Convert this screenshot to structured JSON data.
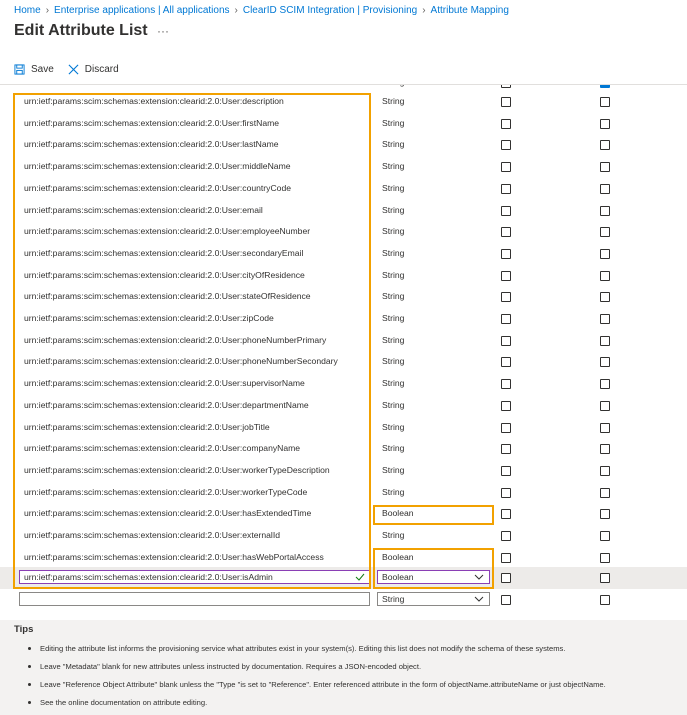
{
  "breadcrumb": {
    "items": [
      "Home",
      "Enterprise applications | All applications",
      "ClearID SCIM Integration | Provisioning",
      "Attribute Mapping"
    ]
  },
  "page": {
    "title": "Edit Attribute List",
    "more": "···"
  },
  "toolbar": {
    "save_label": "Save",
    "discard_label": "Discard"
  },
  "partial_row_type": "String",
  "rows": [
    {
      "name": "urn:ietf:params:scim:schemas:extension:clearid:2.0:User:description",
      "type": "String"
    },
    {
      "name": "urn:ietf:params:scim:schemas:extension:clearid:2.0:User:firstName",
      "type": "String"
    },
    {
      "name": "urn:ietf:params:scim:schemas:extension:clearid:2.0:User:lastName",
      "type": "String"
    },
    {
      "name": "urn:ietf:params:scim:schemas:extension:clearid:2.0:User:middleName",
      "type": "String"
    },
    {
      "name": "urn:ietf:params:scim:schemas:extension:clearid:2.0:User:countryCode",
      "type": "String"
    },
    {
      "name": "urn:ietf:params:scim:schemas:extension:clearid:2.0:User:email",
      "type": "String"
    },
    {
      "name": "urn:ietf:params:scim:schemas:extension:clearid:2.0:User:employeeNumber",
      "type": "String"
    },
    {
      "name": "urn:ietf:params:scim:schemas:extension:clearid:2.0:User:secondaryEmail",
      "type": "String"
    },
    {
      "name": "urn:ietf:params:scim:schemas:extension:clearid:2.0:User:cityOfResidence",
      "type": "String"
    },
    {
      "name": "urn:ietf:params:scim:schemas:extension:clearid:2.0:User:stateOfResidence",
      "type": "String"
    },
    {
      "name": "urn:ietf:params:scim:schemas:extension:clearid:2.0:User:zipCode",
      "type": "String"
    },
    {
      "name": "urn:ietf:params:scim:schemas:extension:clearid:2.0:User:phoneNumberPrimary",
      "type": "String"
    },
    {
      "name": "urn:ietf:params:scim:schemas:extension:clearid:2.0:User:phoneNumberSecondary",
      "type": "String"
    },
    {
      "name": "urn:ietf:params:scim:schemas:extension:clearid:2.0:User:supervisorName",
      "type": "String"
    },
    {
      "name": "urn:ietf:params:scim:schemas:extension:clearid:2.0:User:departmentName",
      "type": "String"
    },
    {
      "name": "urn:ietf:params:scim:schemas:extension:clearid:2.0:User:jobTitle",
      "type": "String"
    },
    {
      "name": "urn:ietf:params:scim:schemas:extension:clearid:2.0:User:companyName",
      "type": "String"
    },
    {
      "name": "urn:ietf:params:scim:schemas:extension:clearid:2.0:User:workerTypeDescription",
      "type": "String"
    },
    {
      "name": "urn:ietf:params:scim:schemas:extension:clearid:2.0:User:workerTypeCode",
      "type": "String"
    },
    {
      "name": "urn:ietf:params:scim:schemas:extension:clearid:2.0:User:hasExtendedTime",
      "type": "Boolean"
    },
    {
      "name": "urn:ietf:params:scim:schemas:extension:clearid:2.0:User:externalId",
      "type": "String"
    },
    {
      "name": "urn:ietf:params:scim:schemas:extension:clearid:2.0:User:hasWebPortalAccess",
      "type": "Boolean"
    }
  ],
  "editing_row": {
    "name": "urn:ietf:params:scim:schemas:extension:clearid:2.0:User:isAdmin",
    "type": "Boolean"
  },
  "new_row": {
    "name": "",
    "type": "String"
  },
  "tips": {
    "title": "Tips",
    "items": [
      "Editing the attribute list informs the provisioning service what attributes exist in your system(s). Editing this list does not modify the schema of these systems.",
      "Leave \"Metadata\" blank for new attributes unless instructed by documentation. Requires a JSON-encoded object.",
      "Leave \"Reference Object Attribute\" blank unless the \"Type \"is set to \"Reference\". Enter referenced attribute in the form of objectName.attributeName or just objectName.",
      "See the online documentation on attribute editing."
    ]
  },
  "colors": {
    "link": "#0078d4",
    "highlight": "#f2a100",
    "focus": "#8a3fb5"
  }
}
